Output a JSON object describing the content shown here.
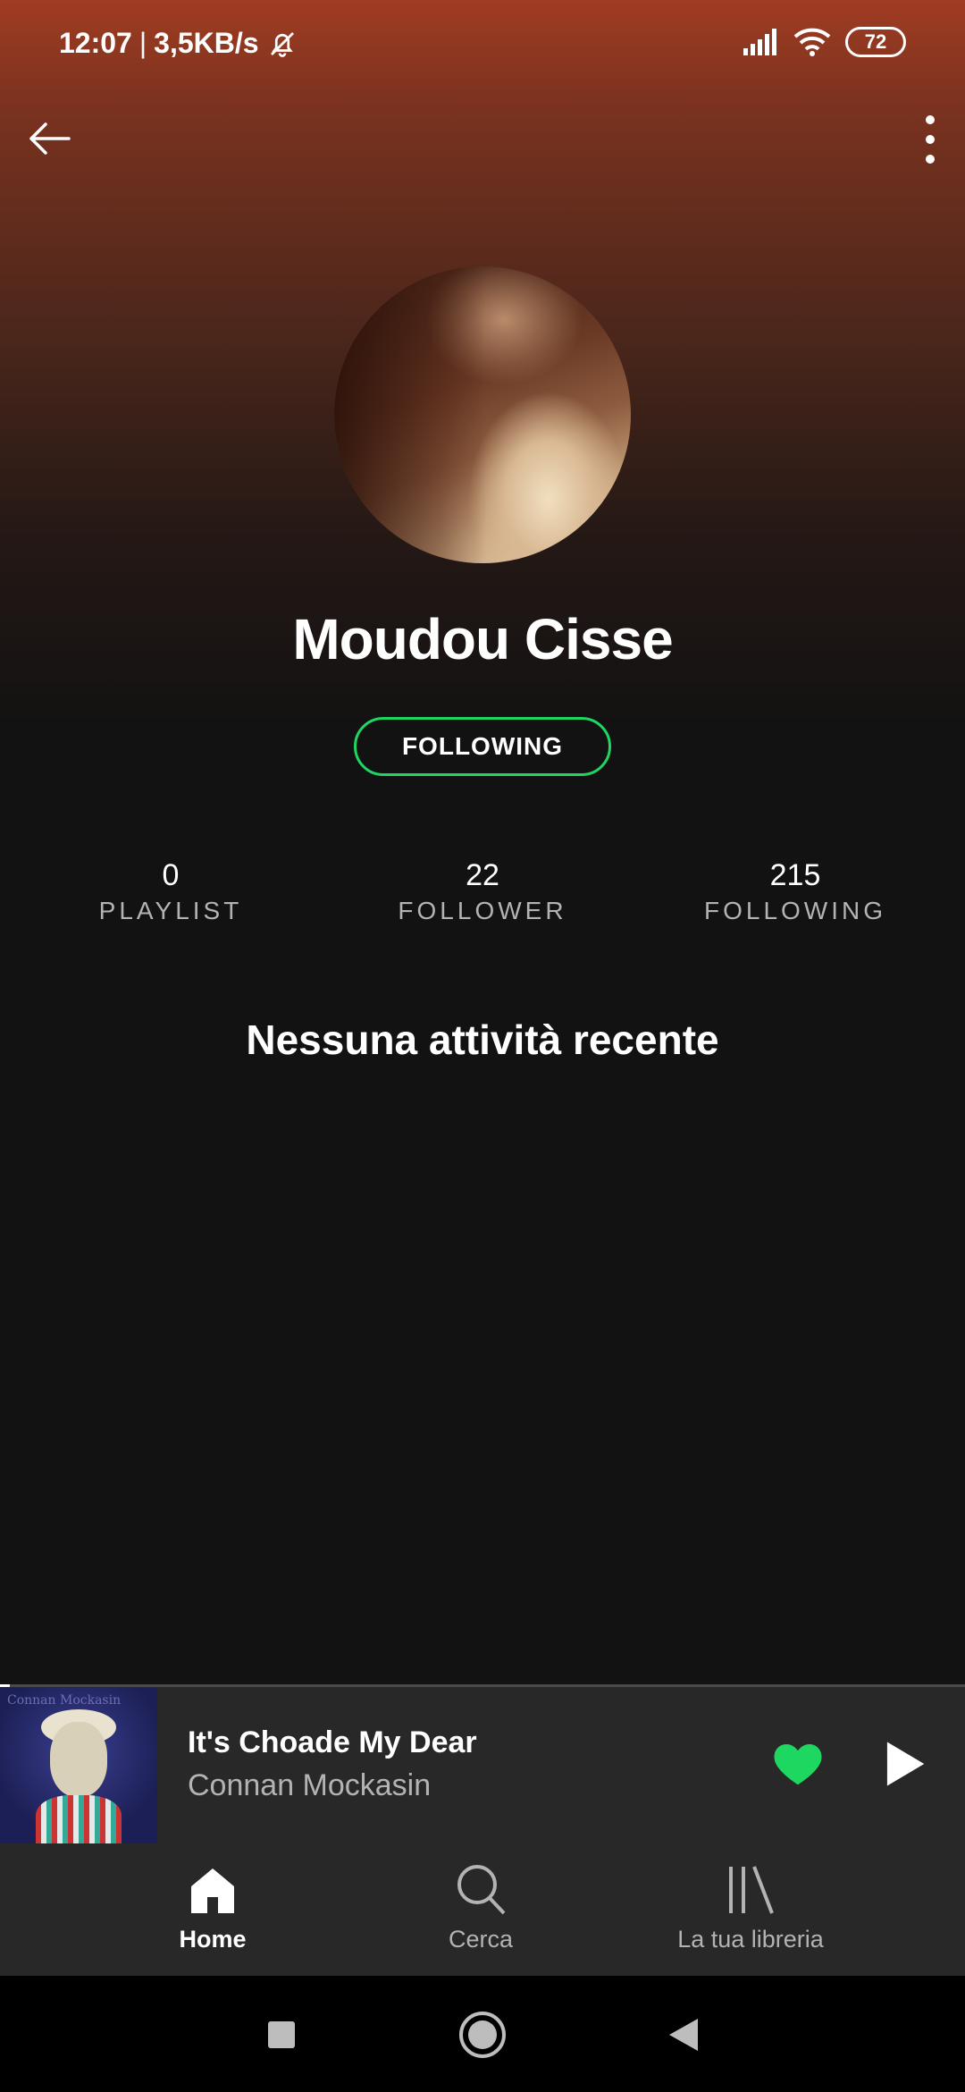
{
  "status_bar": {
    "time": "12:07",
    "separator": "|",
    "net_speed": "3,5KB/s",
    "battery": "72",
    "icons": [
      "bell-off-icon",
      "signal-icon",
      "wifi-icon",
      "battery-icon"
    ]
  },
  "header": {
    "back_icon": "arrow-left-icon",
    "more_icon": "more-vertical-icon"
  },
  "profile": {
    "name": "Moudou Cisse",
    "follow_button": "FOLLOWING",
    "stats": [
      {
        "value": "0",
        "label": "PLAYLIST"
      },
      {
        "value": "22",
        "label": "FOLLOWER"
      },
      {
        "value": "215",
        "label": "FOLLOWING"
      }
    ],
    "empty_message": "Nessuna attività recente"
  },
  "now_playing": {
    "title": "It's Choade My Dear",
    "artist": "Connan Mockasin",
    "album_text": "Connan Mockasin",
    "liked": true,
    "progress": 0.01
  },
  "bottom_nav": {
    "items": [
      {
        "label": "Home",
        "icon": "home-icon",
        "active": true
      },
      {
        "label": "Cerca",
        "icon": "search-icon",
        "active": false
      },
      {
        "label": "La tua libreria",
        "icon": "library-icon",
        "active": false
      }
    ]
  },
  "colors": {
    "accent": "#1ed760",
    "background": "#121212",
    "header_top": "#a03c22",
    "player_bg": "#282828"
  }
}
